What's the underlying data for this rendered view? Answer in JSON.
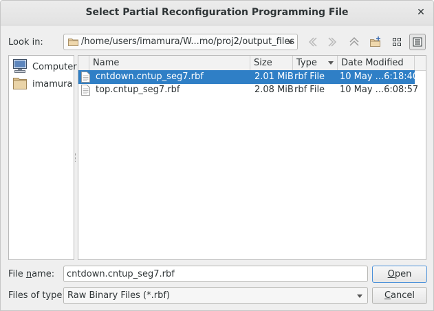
{
  "window": {
    "title": "Select Partial Reconfiguration Programming File",
    "close_glyph": "✕"
  },
  "lookin": {
    "label": "Look in:",
    "path": "/home/users/imamura/W...mo/proj2/output_files"
  },
  "toolbar": {
    "back_icon": "back-arrow-icon",
    "forward_icon": "forward-arrow-icon",
    "parent_icon": "parent-directory-icon",
    "new_folder_icon": "new-folder-icon",
    "list_view_icon": "list-view-icon",
    "detail_view_icon": "detail-view-icon"
  },
  "sidebar": {
    "items": [
      {
        "label": "Computer",
        "icon": "computer-icon"
      },
      {
        "label": "imamura",
        "icon": "folder-icon"
      }
    ]
  },
  "filelist": {
    "columns": [
      "Name",
      "Size",
      "Type",
      "Date Modified"
    ],
    "rows": [
      {
        "name": "cntdown.cntup_seg7.rbf",
        "size": "2.01 MiB",
        "type": "rbf File",
        "date": "10 May ...6:18:40",
        "selected": true
      },
      {
        "name": "top.cntup_seg7.rbf",
        "size": "2.08 MiB",
        "type": "rbf File",
        "date": "10 May ...6:08:57",
        "selected": false
      }
    ]
  },
  "filename": {
    "label_prefix": "File ",
    "label_accel": "n",
    "label_suffix": "ame:",
    "value": "cntdown.cntup_seg7.rbf"
  },
  "filetype": {
    "label": "Files of type:",
    "value": "Raw Binary Files (*.rbf)"
  },
  "buttons": {
    "open_accel": "O",
    "open_rest": "pen",
    "cancel_accel": "C",
    "cancel_rest": "ancel"
  },
  "colors": {
    "selection": "#2f7fc6",
    "default_button_border": "#4a90d9"
  }
}
